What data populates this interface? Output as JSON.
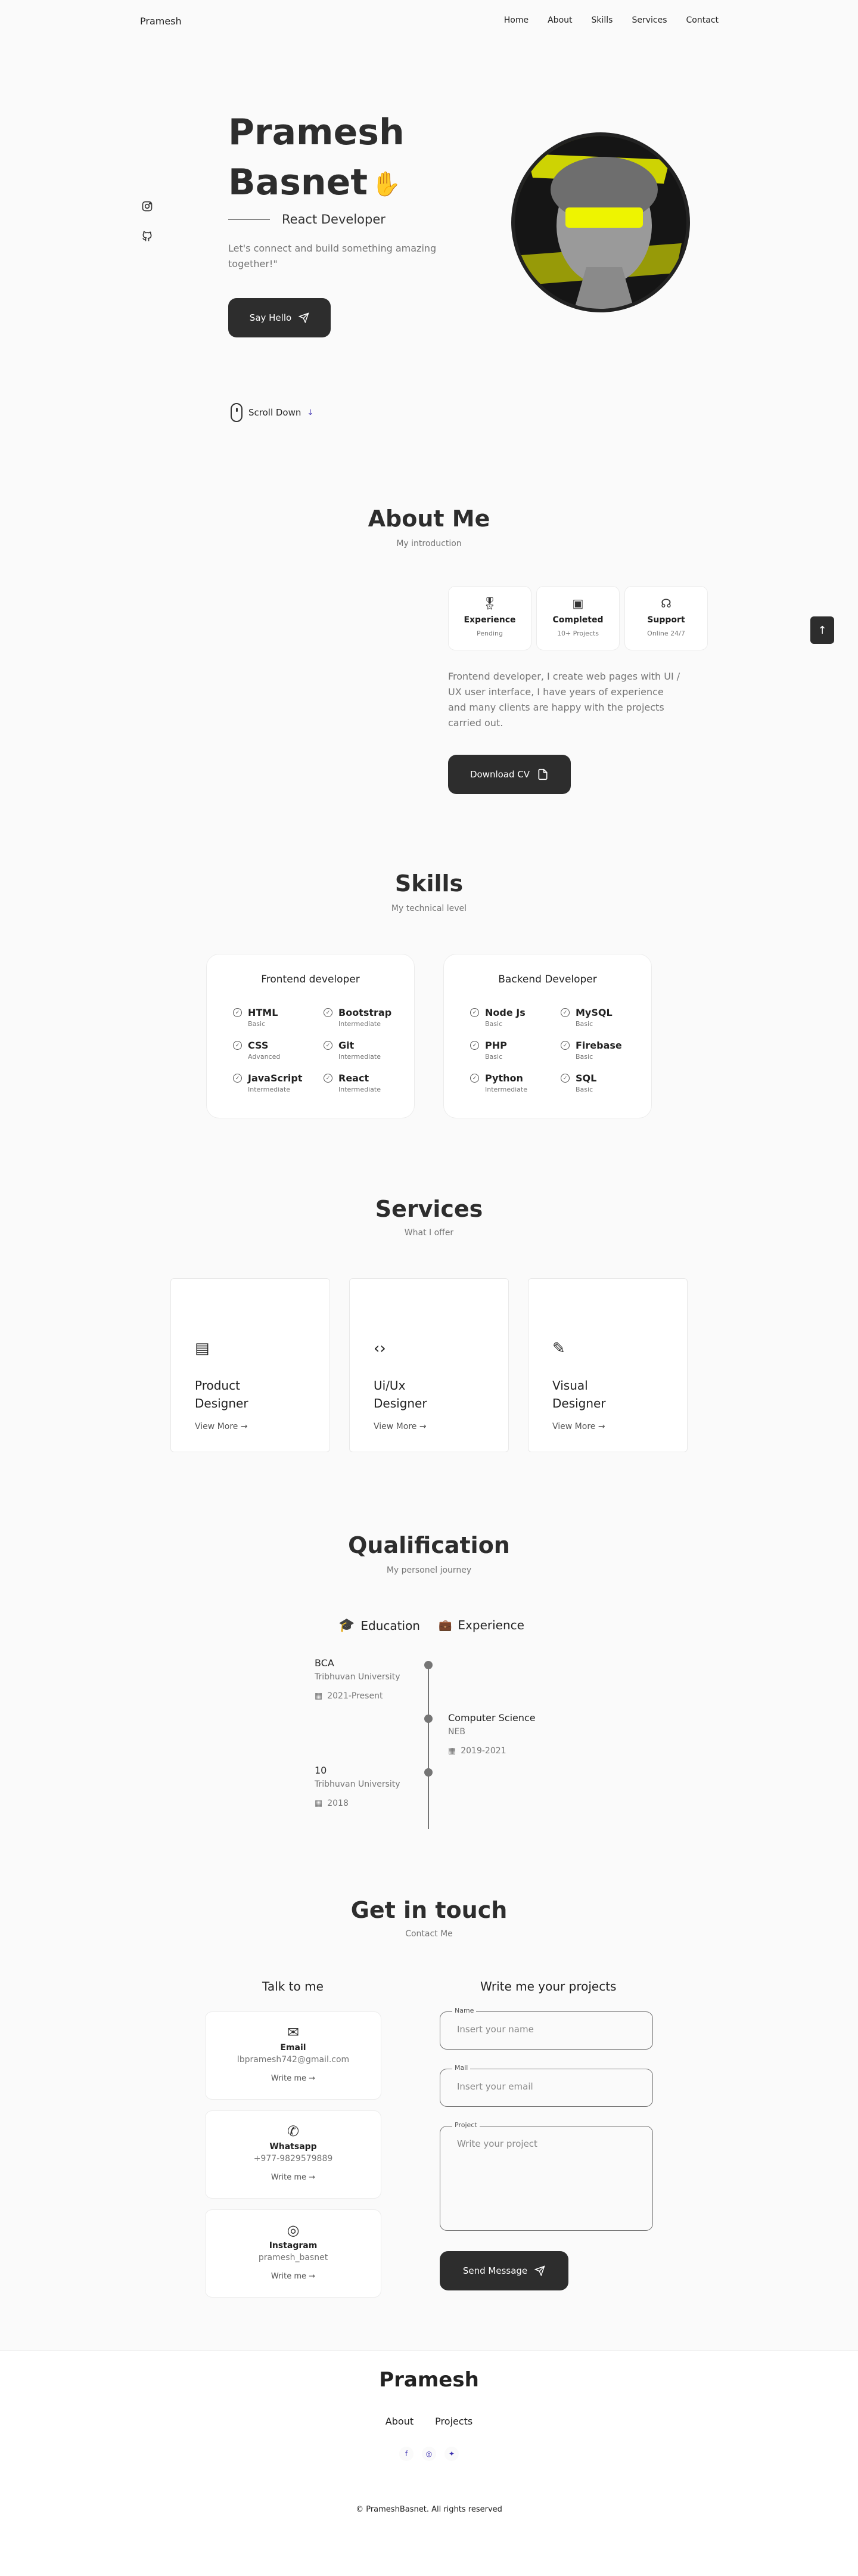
{
  "header": {
    "logo": "Pramesh",
    "nav": [
      "Home",
      "About",
      "Skills",
      "Services",
      "Contact"
    ]
  },
  "hero": {
    "first_name": "Pramesh",
    "last_name": "Basnet",
    "role": "React Developer",
    "description": "Let's connect and build something amazing together!\"",
    "cta": "Say Hello",
    "scroll": "Scroll Down"
  },
  "about": {
    "title": "About Me",
    "subtitle": "My introduction",
    "boxes": [
      {
        "title": "Experience",
        "sub": "Pending"
      },
      {
        "title": "Completed",
        "sub": "10+ Projects"
      },
      {
        "title": "Support",
        "sub": "Online 24/7"
      }
    ],
    "description": "Frontend developer, I create web pages with UI / UX user interface, I have years of experience and many clients are happy with the projects carried out.",
    "cta": "Download CV"
  },
  "skills": {
    "title": "Skills",
    "subtitle": "My technical level",
    "frontend": {
      "title": "Frontend developer",
      "items": [
        {
          "name": "HTML",
          "level": "Basic"
        },
        {
          "name": "Bootstrap",
          "level": "Intermediate"
        },
        {
          "name": "CSS",
          "level": "Advanced"
        },
        {
          "name": "Git",
          "level": "Intermediate"
        },
        {
          "name": "JavaScript",
          "level": "Intermediate"
        },
        {
          "name": "React",
          "level": "Intermediate"
        }
      ]
    },
    "backend": {
      "title": "Backend Developer",
      "items": [
        {
          "name": "Node Js",
          "level": "Basic"
        },
        {
          "name": "MySQL",
          "level": "Basic"
        },
        {
          "name": "PHP",
          "level": "Basic"
        },
        {
          "name": "Firebase",
          "level": "Basic"
        },
        {
          "name": "Python",
          "level": "Intermediate"
        },
        {
          "name": "SQL",
          "level": "Basic"
        }
      ]
    }
  },
  "services": {
    "title": "Services",
    "subtitle": "What I offer",
    "items": [
      {
        "line1": "Product",
        "line2": "Designer",
        "more": "View More"
      },
      {
        "line1": "Ui/Ux",
        "line2": "Designer",
        "more": "View More"
      },
      {
        "line1": "Visual",
        "line2": "Designer",
        "more": "View More"
      }
    ]
  },
  "qualification": {
    "title": "Qualification",
    "subtitle": "My personel journey",
    "tabs": [
      "Education",
      "Experience"
    ],
    "items": [
      {
        "title": "BCA",
        "org": "Tribhuvan University",
        "date": "2021-Present"
      },
      {
        "title": "Computer Science",
        "org": "NEB",
        "date": "2019-2021"
      },
      {
        "title": "10",
        "org": "Tribhuvan University",
        "date": "2018"
      }
    ]
  },
  "contact": {
    "title": "Get in touch",
    "subtitle": "Contact Me",
    "left_title": "Talk to me",
    "right_title": "Write me your projects",
    "cards": [
      {
        "title": "Email",
        "value": "lbpramesh742@gmail.com",
        "cta": "Write me"
      },
      {
        "title": "Whatsapp",
        "value": "+977-9829579889",
        "cta": "Write me"
      },
      {
        "title": "Instagram",
        "value": "pramesh_basnet",
        "cta": "Write me"
      }
    ],
    "form": {
      "name_label": "Name",
      "name_placeholder": "Insert your name",
      "mail_label": "Mail",
      "mail_placeholder": "Insert your email",
      "project_label": "Project",
      "project_placeholder": "Write your project",
      "submit": "Send Message"
    }
  },
  "footer": {
    "title": "Pramesh",
    "links": [
      "About",
      "Projects"
    ],
    "copyright": "© PrameshBasnet. All rights reserved"
  }
}
